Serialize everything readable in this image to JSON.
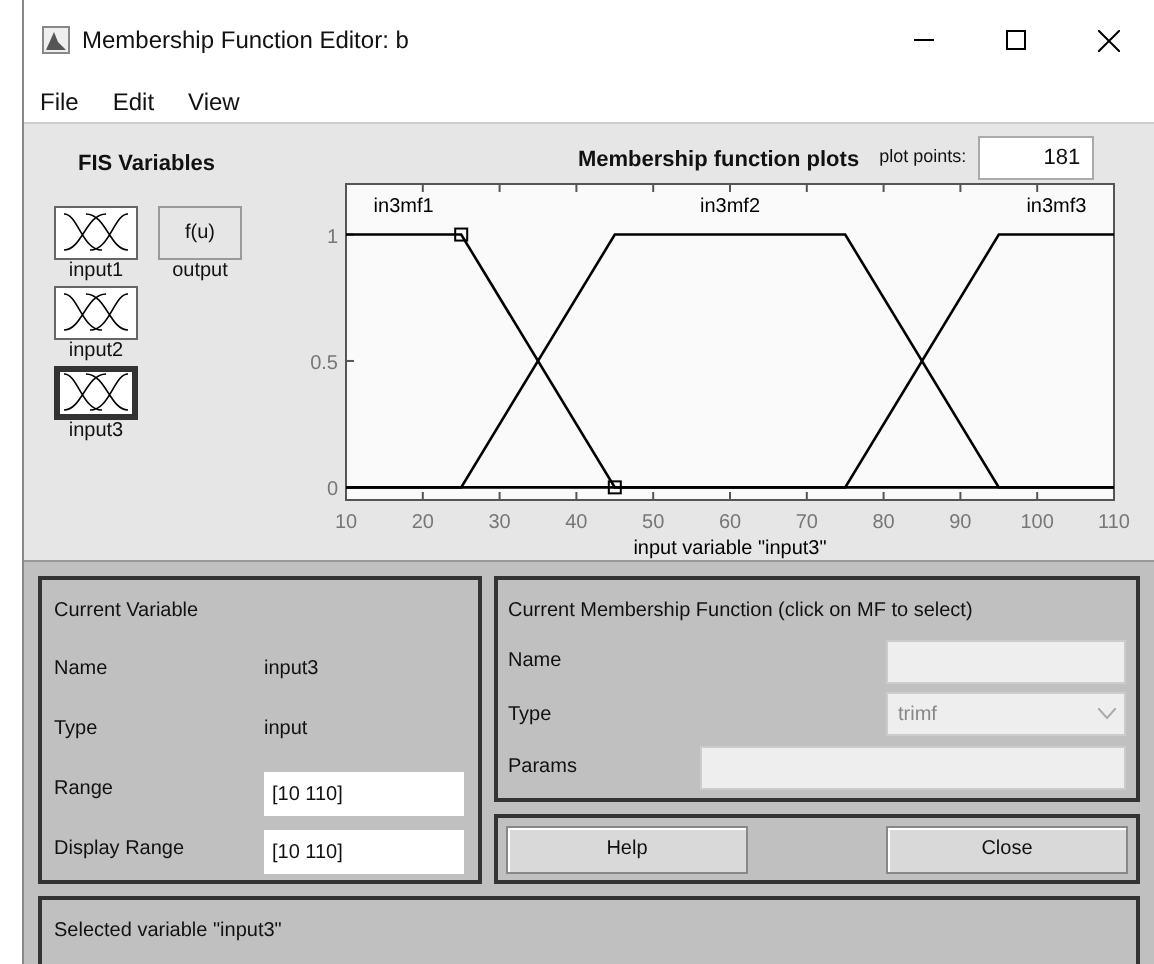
{
  "window": {
    "title": "Membership Function Editor: b"
  },
  "menu": [
    "File",
    "Edit",
    "View"
  ],
  "fis_variables": {
    "title": "FIS Variables",
    "items": [
      {
        "label": "input1",
        "kind": "input",
        "selected": false
      },
      {
        "label": "output",
        "kind": "output",
        "icon_text": "f(u)",
        "selected": false
      },
      {
        "label": "input2",
        "kind": "input",
        "selected": false
      },
      {
        "label": "input3",
        "kind": "input",
        "selected": true
      }
    ]
  },
  "plot": {
    "title": "Membership function plots",
    "plot_points_label": "plot points:",
    "plot_points": "181",
    "chart_data": {
      "type": "line",
      "xlabel": "input variable \"input3\"",
      "x": [
        10,
        25,
        45,
        75,
        95,
        110
      ],
      "series": [
        {
          "name": "in3mf1",
          "color": "#000000",
          "values": [
            1,
            1,
            0,
            0,
            0,
            0
          ]
        },
        {
          "name": "in3mf2",
          "color": "#000000",
          "values": [
            0,
            0,
            1,
            1,
            0,
            0
          ]
        },
        {
          "name": "in3mf3",
          "color": "#000000",
          "values": [
            0,
            0,
            0,
            0,
            1,
            1
          ]
        }
      ],
      "xlim": [
        10,
        110
      ],
      "ylim": [
        -0.05,
        1.2
      ],
      "xticks": [
        10,
        20,
        30,
        40,
        50,
        60,
        70,
        80,
        90,
        100,
        110
      ],
      "yticks": [
        0,
        0.5,
        1
      ]
    },
    "curves": [
      {
        "selected": true
      },
      {
        "selected": false
      },
      {
        "selected": false
      }
    ]
  },
  "current_variable": {
    "title": "Current Variable",
    "name_label": "Name",
    "name": "input3",
    "type_label": "Type",
    "type": "input",
    "range_label": "Range",
    "range": "[10 110]",
    "display_range_label": "Display Range",
    "display_range": "[10 110]"
  },
  "current_mf": {
    "title": "Current Membership Function (click on MF to select)",
    "name_label": "Name",
    "type_label": "Type",
    "type": "trimf",
    "params_label": "Params"
  },
  "buttons": [
    "Help",
    "Close"
  ],
  "status": "Selected variable \"input3\""
}
